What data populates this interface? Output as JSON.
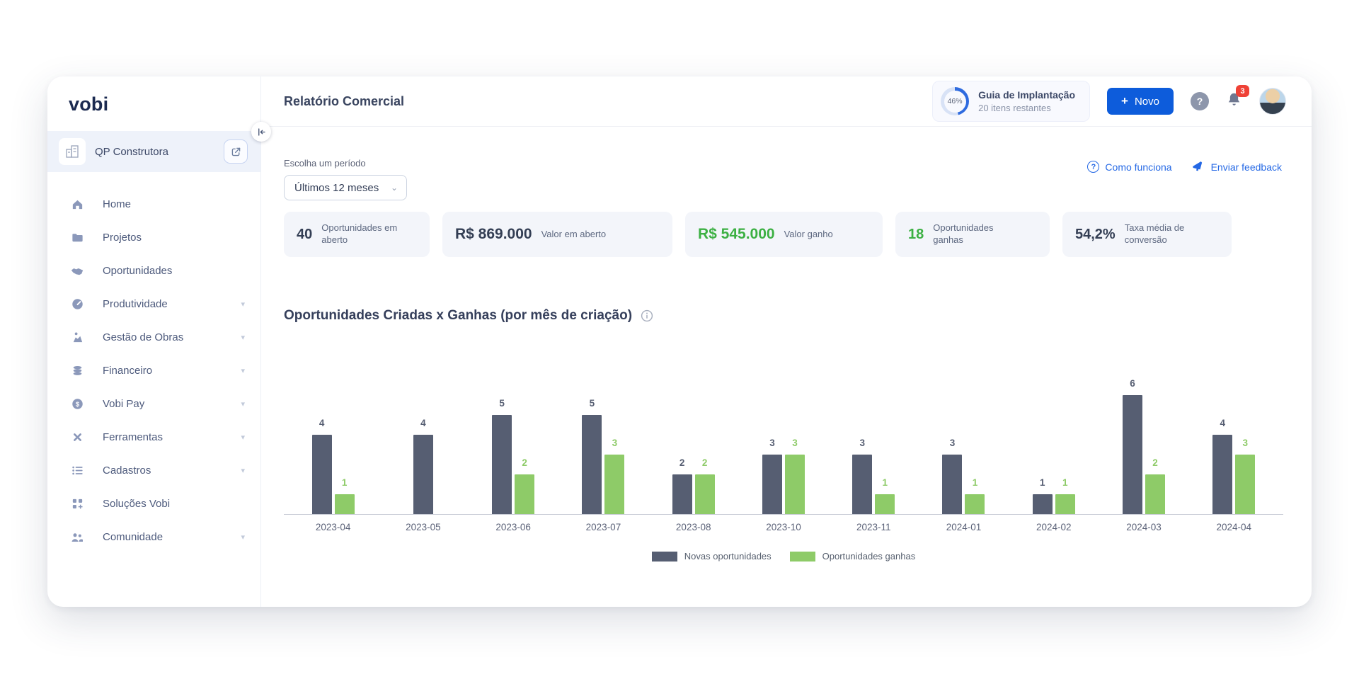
{
  "brand": {
    "logo_text": "vobi"
  },
  "sidebar": {
    "workspace": {
      "name": "QP Construtora"
    },
    "items": [
      {
        "label": "Home",
        "icon": "home-icon",
        "chevron": false
      },
      {
        "label": "Projetos",
        "icon": "folder-icon",
        "chevron": false
      },
      {
        "label": "Oportunidades",
        "icon": "handshake-icon",
        "chevron": false
      },
      {
        "label": "Produtividade",
        "icon": "gauge-icon",
        "chevron": true
      },
      {
        "label": "Gestão de Obras",
        "icon": "construction-icon",
        "chevron": true
      },
      {
        "label": "Financeiro",
        "icon": "coins-icon",
        "chevron": true
      },
      {
        "label": "Vobi Pay",
        "icon": "dollar-circle-icon",
        "chevron": true
      },
      {
        "label": "Ferramentas",
        "icon": "tools-icon",
        "chevron": true
      },
      {
        "label": "Cadastros",
        "icon": "list-icon",
        "chevron": true
      },
      {
        "label": "Soluções Vobi",
        "icon": "grid-plus-icon",
        "chevron": false
      },
      {
        "label": "Comunidade",
        "icon": "people-icon",
        "chevron": true
      }
    ]
  },
  "header": {
    "title": "Relatório Comercial",
    "guide": {
      "percent": "46%",
      "title": "Guia de Implantação",
      "subtitle": "20 itens restantes"
    },
    "new_button_label": "Novo",
    "notification_count": "3"
  },
  "toolbar": {
    "period_label": "Escolha um período",
    "period_value": "Últimos 12 meses",
    "how_it_works": "Como funciona",
    "send_feedback": "Enviar feedback"
  },
  "kpis": [
    {
      "value": "40",
      "label": "Oportunidades em aberto",
      "color": "dark",
      "style": "num"
    },
    {
      "value": "R$ 869.000",
      "label": "Valor em aberto",
      "color": "dark",
      "style": "money"
    },
    {
      "value": "R$ 545.000",
      "label": "Valor ganho",
      "color": "green",
      "style": "money"
    },
    {
      "value": "18",
      "label": "Oportunidades ganhas",
      "color": "green",
      "style": "num"
    },
    {
      "value": "54,2%",
      "label": "Taxa média de conversão",
      "color": "dark",
      "style": "num"
    }
  ],
  "chart_data": {
    "type": "bar",
    "title": "Oportunidades Criadas x Ganhas (por mês de criação)",
    "categories": [
      "2023-04",
      "2023-05",
      "2023-06",
      "2023-07",
      "2023-08",
      "2023-10",
      "2023-11",
      "2024-01",
      "2024-02",
      "2024-03",
      "2024-04"
    ],
    "series": [
      {
        "name": "Novas oportunidades",
        "color": "#565e72",
        "values": [
          4,
          4,
          5,
          5,
          2,
          3,
          3,
          3,
          1,
          6,
          4
        ]
      },
      {
        "name": "Oportunidades ganhas",
        "color": "#8ecb68",
        "values": [
          1,
          0,
          2,
          3,
          2,
          3,
          1,
          1,
          1,
          2,
          3
        ]
      }
    ],
    "ylim": [
      0,
      6
    ],
    "value_labels": true,
    "legend_position": "bottom",
    "grid": false
  },
  "colors": {
    "accent": "#0d5cdb",
    "green": "#3cb043",
    "bar_dark": "#565e72",
    "bar_green": "#8ecb68",
    "badge_red": "#ef4136"
  }
}
